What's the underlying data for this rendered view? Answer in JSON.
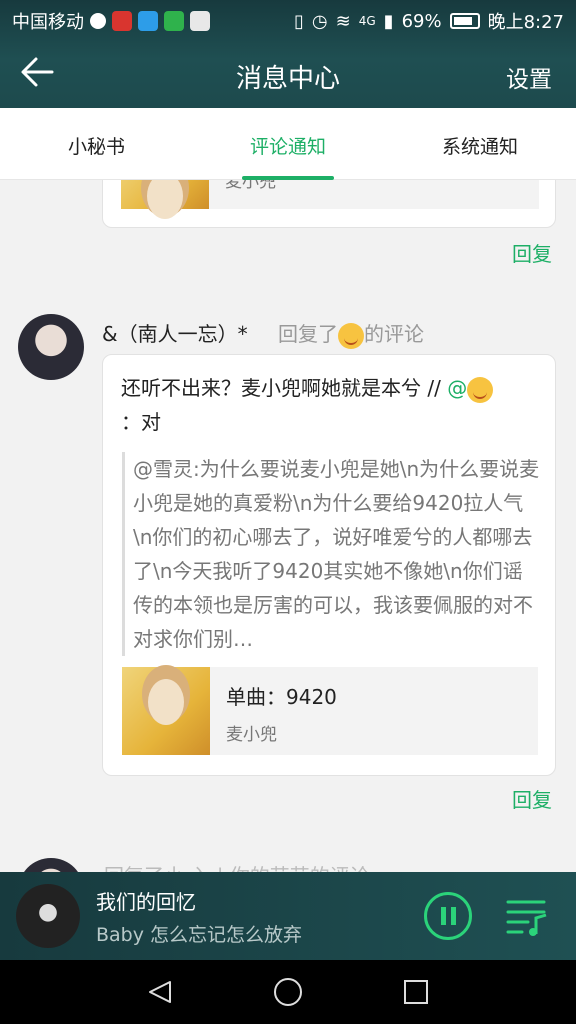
{
  "status_bar": {
    "carrier": "中国移动",
    "network": "4G",
    "battery": "69%",
    "time": "晚上8:27"
  },
  "header": {
    "title": "消息中心",
    "settings_label": "设置"
  },
  "tabs": [
    {
      "label": "小秘书",
      "active": false
    },
    {
      "label": "评论通知",
      "active": true
    },
    {
      "label": "系统通知",
      "active": false
    }
  ],
  "items": [
    {
      "song_artist": "麦小兜",
      "reply_label": "回复"
    },
    {
      "username": "&（南人一忘）*",
      "action_prefix": "回复了",
      "action_suffix": "的评论",
      "comment_line1": "还听不出来？麦小兜啊她就是本兮 // ",
      "comment_at": "@",
      "comment_line2": "：对",
      "quote": "@雪灵:为什么要说麦小兜是她\\n为什么要说麦小兜是她的真爱粉\\n为什么要给9420拉人气\\n你们的初心哪去了，说好唯爱兮的人都哪去了\\n今天我听了9420其实她不像她\\n你们谣传的本领也是厉害的可以，我该要佩服的对不对求你们别…",
      "song_title": "单曲：9420",
      "song_artist": "麦小兜",
      "reply_label": "回复"
    },
    {
      "partial_text": "回复了小 入 | 你的芸芸的评论"
    }
  ],
  "player": {
    "title": "我们的回忆",
    "subtitle": "Baby 怎么忘记怎么放弃"
  },
  "colors": {
    "accent": "#1daf66",
    "header_bg": "#1d4a4d"
  }
}
